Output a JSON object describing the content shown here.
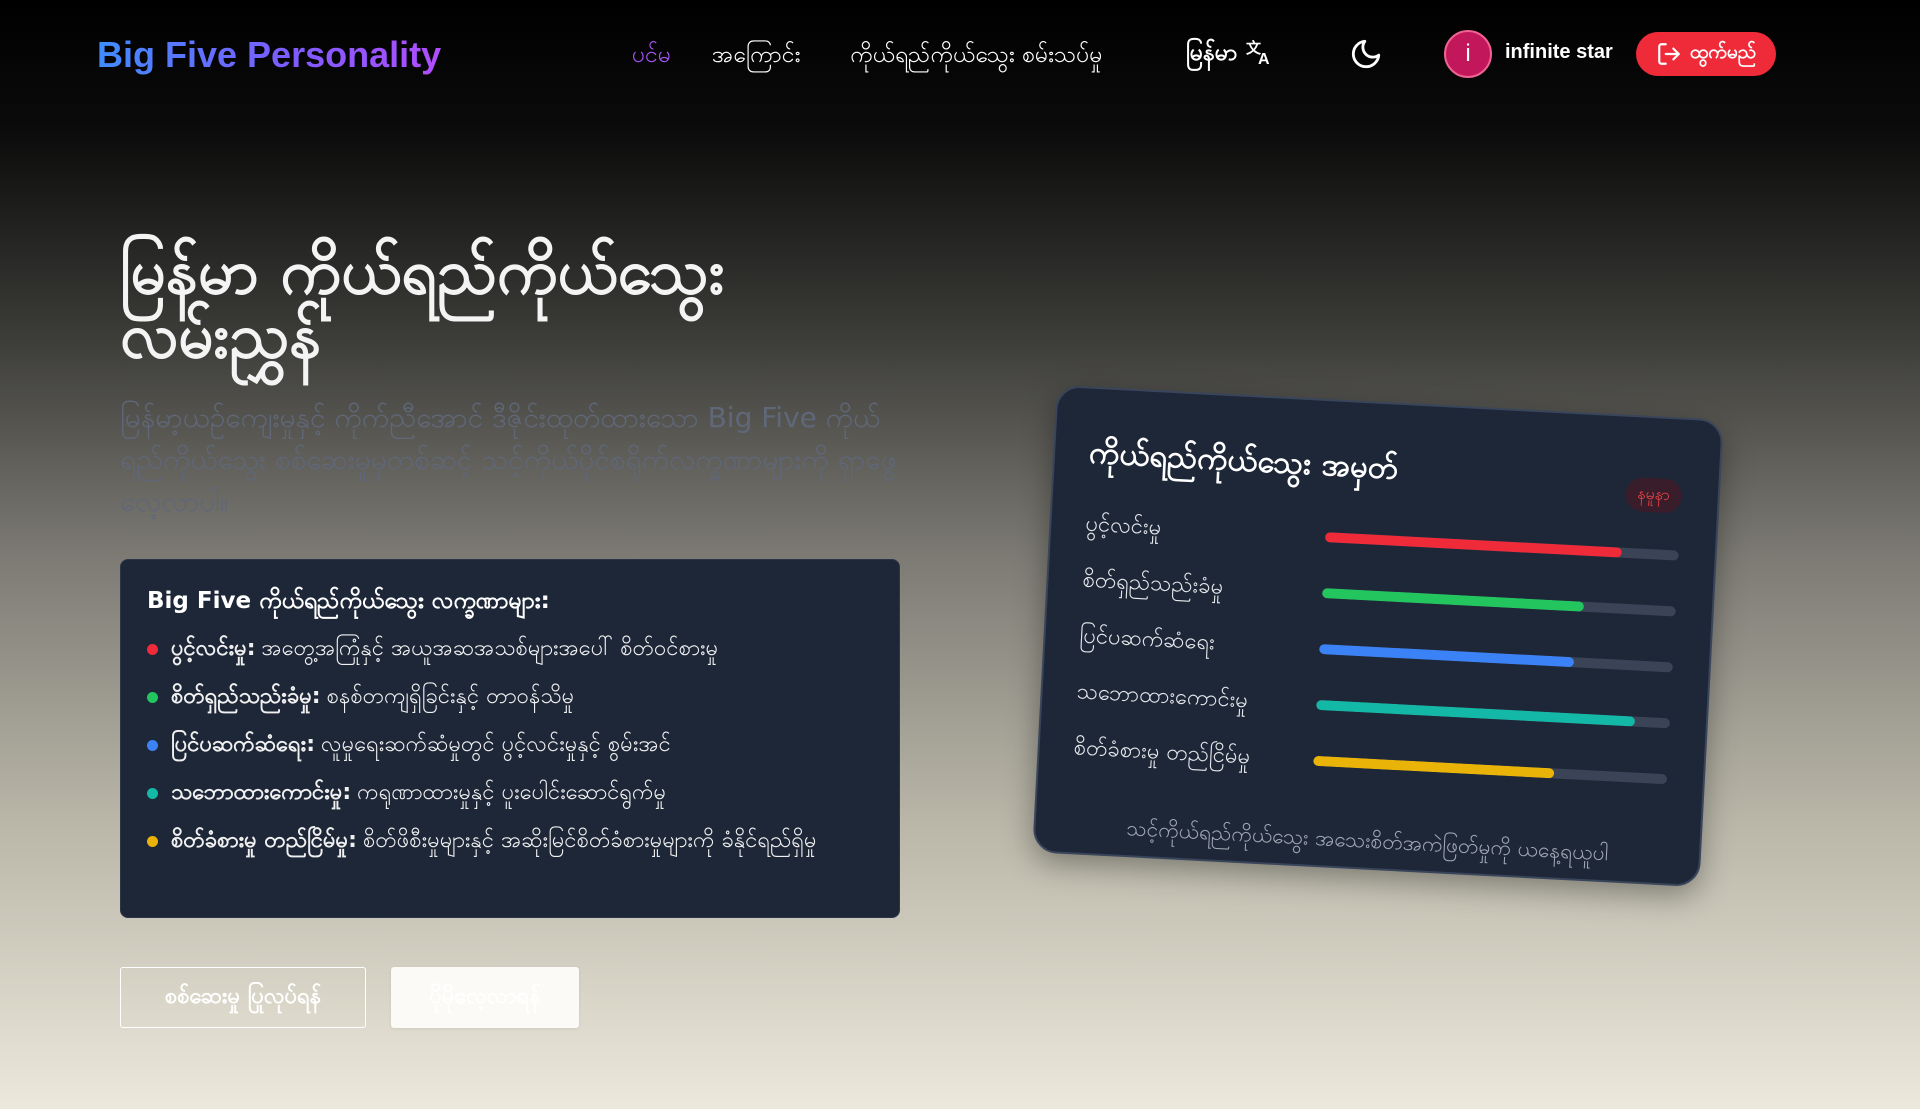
{
  "nav": {
    "logo": "Big Five Personality",
    "links": [
      "ပင်မ",
      "အကြောင်း",
      "ကိုယ်ရည်ကိုယ်သွေး စမ်းသပ်မှု"
    ],
    "language": "မြန်မာ",
    "language_icon": "translate-icon",
    "theme_icon": "moon-icon",
    "user": {
      "avatar_initial": "i",
      "name": "infinite star"
    },
    "logout_label": "ထွက်မည်",
    "logout_icon": "logout-icon"
  },
  "hero": {
    "title": "မြန်မာ ကိုယ်ရည်ကိုယ်သွေး လမ်းညွှန်",
    "subtitle": "မြန်မာ့ယဉ်ကျေးမှုနှင့် ကိုက်ညီအောင် ဒီဇိုင်းထုတ်ထားသော Big Five ကိုယ်ရည်ကိုယ်သွေး စစ်ဆေးမှုမှတစ်ဆင့် သင့်ကိုယ်ပိုင်စရိုက်လက္ခဏာများကို ရှာဖွေလေ့လာပါ။",
    "traits_title": "Big Five ကိုယ်ရည်ကိုယ်သွေး လက္ခဏာများ:",
    "traits": [
      {
        "name": "ပွင့်လင်းမှု:",
        "desc": "အတွေ့အကြုံနှင့် အယူအဆအသစ်များအပေါ် စိတ်ဝင်စားမှု",
        "color": "#ef2b3a"
      },
      {
        "name": "စိတ်ရှည်သည်းခံမှု:",
        "desc": "စနစ်တကျရှိခြင်းနှင့် တာဝန်သိမှု",
        "color": "#22c55e"
      },
      {
        "name": "ပြင်ပဆက်ဆံရေး:",
        "desc": "လူမှုရေးဆက်ဆံမှုတွင် ပွင့်လင်းမှုနှင့် စွမ်းအင်",
        "color": "#3b82f6"
      },
      {
        "name": "သဘောထားကောင်းမှု:",
        "desc": "ကရုဏာထားမှုနှင့် ပူးပေါင်းဆောင်ရွက်မှု",
        "color": "#14b8a6"
      },
      {
        "name": "စိတ်ခံစားမှု တည်ငြိမ်မှု:",
        "desc": "စိတ်ဖိစီးမှုများနှင့် အဆိုးမြင်စိတ်ခံစားမှုများကို ခံနိုင်ရည်ရှိမှု",
        "color": "#eab308"
      }
    ],
    "start_button": "စစ်ဆေးမှု ပြုလုပ်ရန်",
    "more_button": "ပိုမိုလေ့လာရန်"
  },
  "card": {
    "title": "ကိုယ်ရည်ကိုယ်သွေး အမှတ်",
    "badge": "နမူနာ",
    "bars": [
      {
        "label": "ပွင့်လင်းမှု",
        "value": 0.84,
        "color": "#ef2b3a"
      },
      {
        "label": "စိတ်ရှည်သည်းခံမှု",
        "value": 0.74,
        "color": "#22c55e"
      },
      {
        "label": "ပြင်ပဆက်ဆံရေး",
        "value": 0.72,
        "color": "#3b82f6"
      },
      {
        "label": "သဘောထားကောင်းမှု",
        "value": 0.9,
        "color": "#14b8a6"
      },
      {
        "label": "စိတ်ခံစားမှု တည်ငြိမ်မှု",
        "value": 0.68,
        "color": "#eab308"
      }
    ],
    "note": "သင့်ကိုယ်ရည်ကိုယ်သွေး အသေးစိတ်အကဲဖြတ်မှုကို ယနေ့ရယူပါ"
  }
}
